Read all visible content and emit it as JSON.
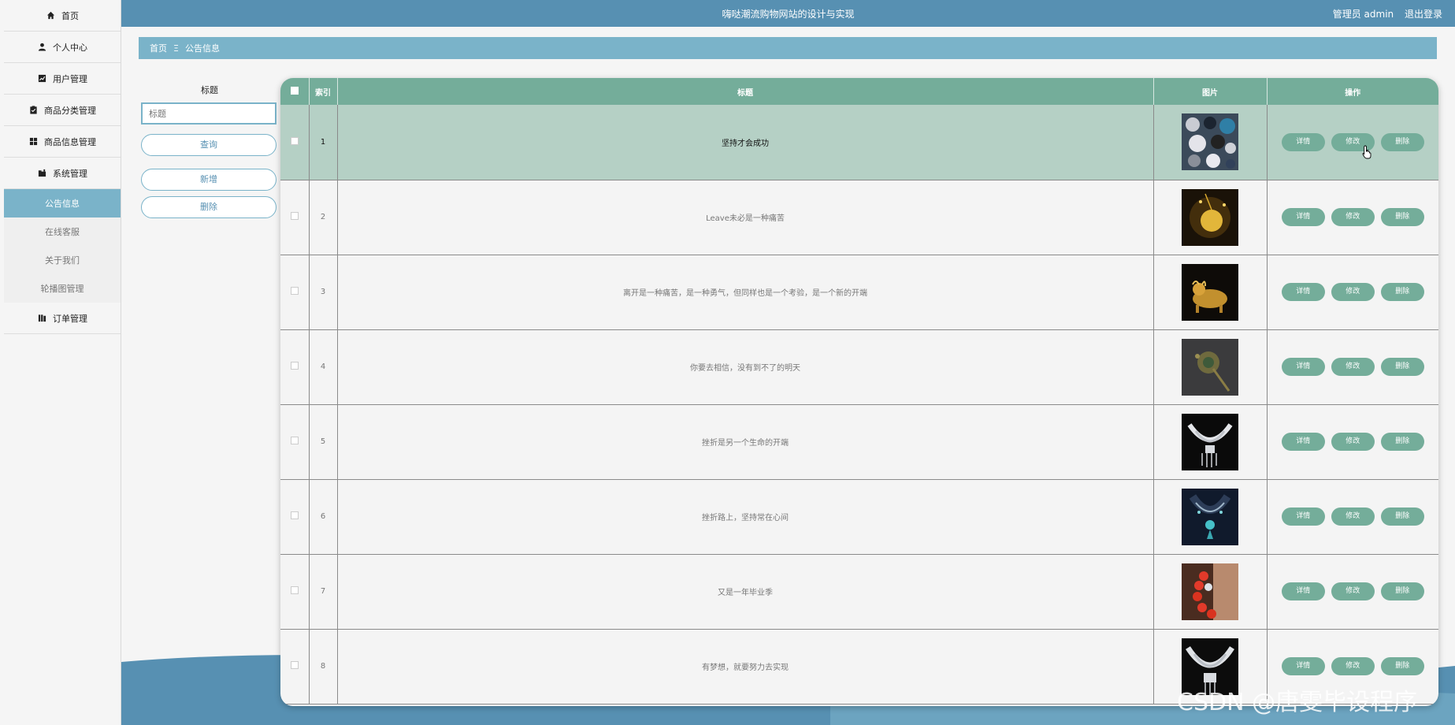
{
  "app": {
    "title": "嗨哒潮流购物网站的设计与实现",
    "user_label": "管理员 admin",
    "logout_label": "退出登录"
  },
  "sidebar": {
    "items": [
      {
        "label": "首页",
        "icon": "home-icon"
      },
      {
        "label": "个人中心",
        "icon": "user-icon"
      },
      {
        "label": "用户管理",
        "icon": "chart-icon"
      },
      {
        "label": "商品分类管理",
        "icon": "clipboard-icon"
      },
      {
        "label": "商品信息管理",
        "icon": "grid-icon"
      },
      {
        "label": "系统管理",
        "icon": "settings-folder-icon"
      }
    ],
    "sub_items": [
      {
        "label": "公告信息",
        "active": true
      },
      {
        "label": "在线客服",
        "active": false
      },
      {
        "label": "关于我们",
        "active": false
      },
      {
        "label": "轮播图管理",
        "active": false
      }
    ],
    "last_item": {
      "label": "订单管理",
      "icon": "book-icon"
    }
  },
  "breadcrumb": {
    "home": "首页",
    "separator": "Ξ",
    "current": "公告信息"
  },
  "search": {
    "label": "标题",
    "placeholder": "标题",
    "query_button": "查询",
    "add_button": "新增",
    "delete_button": "删除"
  },
  "table": {
    "headers": {
      "index": "索引",
      "title": "标题",
      "image": "图片",
      "actions": "操作"
    },
    "action_labels": {
      "detail": "详情",
      "edit": "修改",
      "delete": "删除"
    },
    "rows": [
      {
        "index": "1",
        "title": "坚持才会成功",
        "image": "jewelry-collection",
        "highlighted": true
      },
      {
        "index": "2",
        "title": "Leave未必是一种痛苦",
        "image": "gold-pendant",
        "highlighted": false
      },
      {
        "index": "3",
        "title": "离开是一种痛苦，是一种勇气，但同样也是一个考验，是一个新的开端",
        "image": "gold-bull",
        "highlighted": false
      },
      {
        "index": "4",
        "title": "你要去相信，没有到不了的明天",
        "image": "vintage-brooch",
        "highlighted": false
      },
      {
        "index": "5",
        "title": "挫折是另一个生命的开端",
        "image": "silver-necklace",
        "highlighted": false
      },
      {
        "index": "6",
        "title": "挫折路上，坚持常在心间",
        "image": "blue-crystal-necklace",
        "highlighted": false
      },
      {
        "index": "7",
        "title": "又是一年毕业季",
        "image": "red-bead-bracelet",
        "highlighted": false
      },
      {
        "index": "8",
        "title": "有梦想，就要努力去实现",
        "image": "silver-collar-necklace",
        "highlighted": false
      }
    ]
  },
  "watermark": "CSDN @唐雯毕设程序",
  "colors": {
    "topbar": "#5790b2",
    "breadcrumb": "#7ab3c9",
    "table_header": "#74ad9a",
    "row_highlight": "#b5d0c5"
  }
}
